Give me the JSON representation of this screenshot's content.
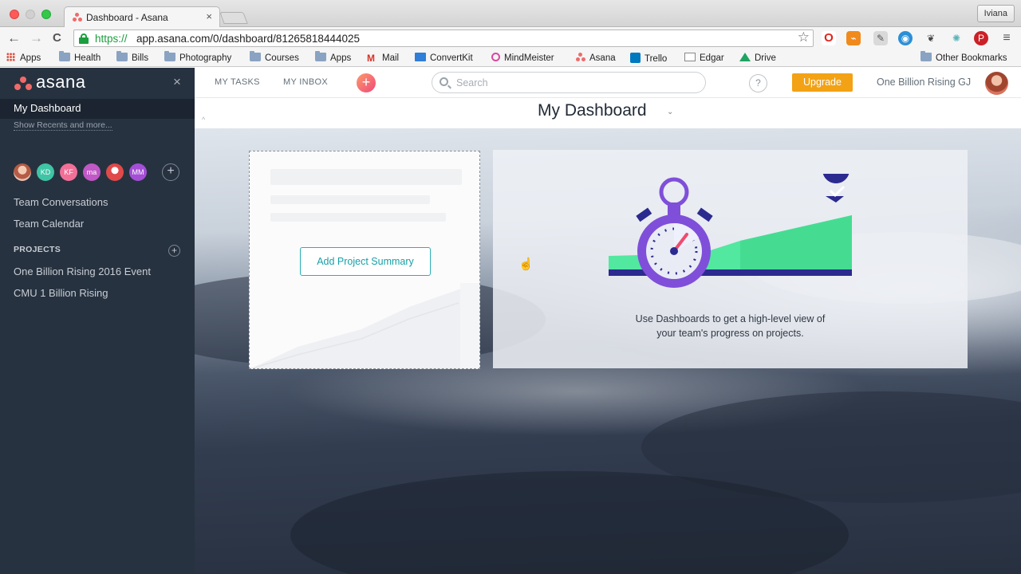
{
  "browser": {
    "tab_title": "Dashboard - Asana",
    "tab_close": "×",
    "profile": "Iviana",
    "back": "←",
    "forward": "→",
    "reload": "C",
    "url_scheme": "https://",
    "url_rest": "app.asana.com/0/dashboard/81265818444025",
    "star": "☆",
    "bookmarks": [
      "Apps",
      "Health",
      "Bills",
      "Photography",
      "Courses",
      "Apps",
      "Mail",
      "ConvertKit",
      "MindMeister",
      "Asana",
      "Trello",
      "Edgar",
      "Drive"
    ],
    "other_bookmarks": "Other Bookmarks"
  },
  "sidebar": {
    "logo": "asana",
    "close": "×",
    "active_item": "My Dashboard",
    "recents": "Show Recents and more...",
    "members": [
      {
        "initials": "",
        "color": "#c9836e"
      },
      {
        "initials": "KD",
        "color": "#3fc4a6"
      },
      {
        "initials": "KF",
        "color": "#f27098"
      },
      {
        "initials": "ma",
        "color": "#c058c6"
      },
      {
        "initials": "",
        "color": "#e04a4a"
      },
      {
        "initials": "MM",
        "color": "#a44fd6"
      }
    ],
    "add_member": "+",
    "links": [
      "Team Conversations",
      "Team Calendar"
    ],
    "projects_heading": "PROJECTS",
    "add_project": "+",
    "projects": [
      "One Billion Rising 2016 Event",
      "CMU 1 Billion Rising"
    ]
  },
  "topbar": {
    "my_tasks": "MY TASKS",
    "my_inbox": "MY INBOX",
    "quick_add": "+",
    "search_placeholder": "Search",
    "help": "?",
    "upgrade": "Upgrade",
    "org": "One Billion Rising GJ"
  },
  "page": {
    "title": "My Dashboard",
    "chevron": "⌄",
    "collapse": "^"
  },
  "dashboard": {
    "add_project_summary": "Add Project Summary",
    "promo_line1": "Use Dashboards to get a high-level view of",
    "promo_line2": "your team's progress on projects."
  },
  "colors": {
    "sidebar_bg": "#273240",
    "accent_teal": "#26b0b5",
    "upgrade_orange": "#f2a214",
    "illustration_purple": "#7f4fd9",
    "illustration_green": "#52e8a0",
    "illustration_navy": "#2b2a8f"
  }
}
